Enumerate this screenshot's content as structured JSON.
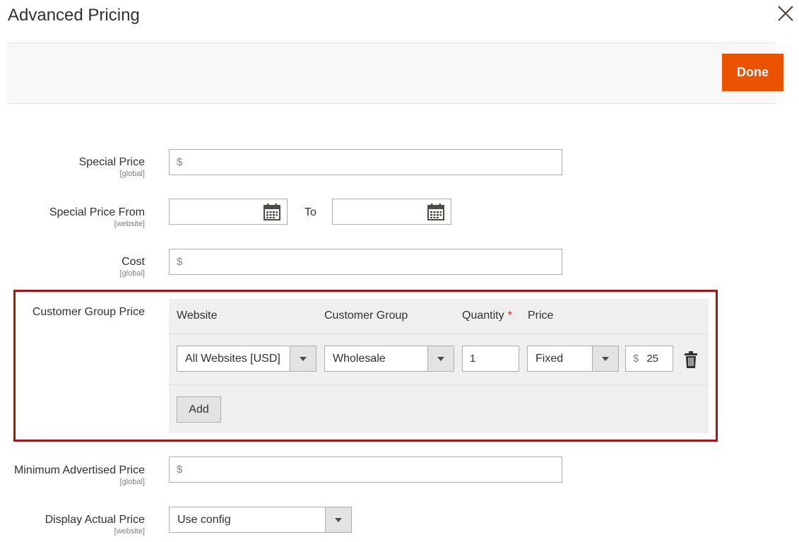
{
  "modal": {
    "title": "Advanced Pricing",
    "close_icon": "close-icon",
    "done_label": "Done",
    "accent_color": "#eb5202",
    "highlight_color": "#a8121a"
  },
  "fields": {
    "special_price": {
      "label": "Special Price",
      "scope": "[global]",
      "prefix": "$",
      "value": ""
    },
    "special_price_from": {
      "label": "Special Price From",
      "scope": "[website]",
      "from_value": "",
      "to_label": "To",
      "to_value": "",
      "icon": "calendar-icon"
    },
    "cost": {
      "label": "Cost",
      "scope": "[global]",
      "prefix": "$",
      "value": ""
    },
    "customer_group_price": {
      "label": "Customer Group Price",
      "columns": {
        "website": "Website",
        "customer_group": "Customer Group",
        "quantity": "Quantity",
        "required_mark": "*",
        "price": "Price"
      },
      "rows": [
        {
          "website": "All Websites [USD]",
          "customer_group": "Wholesale",
          "quantity": "1",
          "price_type": "Fixed",
          "price_prefix": "$",
          "price": "25",
          "delete_icon": "trash-icon"
        }
      ],
      "add_label": "Add"
    },
    "minimum_advertised_price": {
      "label": "Minimum Advertised Price",
      "scope": "[global]",
      "prefix": "$",
      "value": ""
    },
    "display_actual_price": {
      "label": "Display Actual Price",
      "scope": "[website]",
      "value": "Use config"
    }
  }
}
